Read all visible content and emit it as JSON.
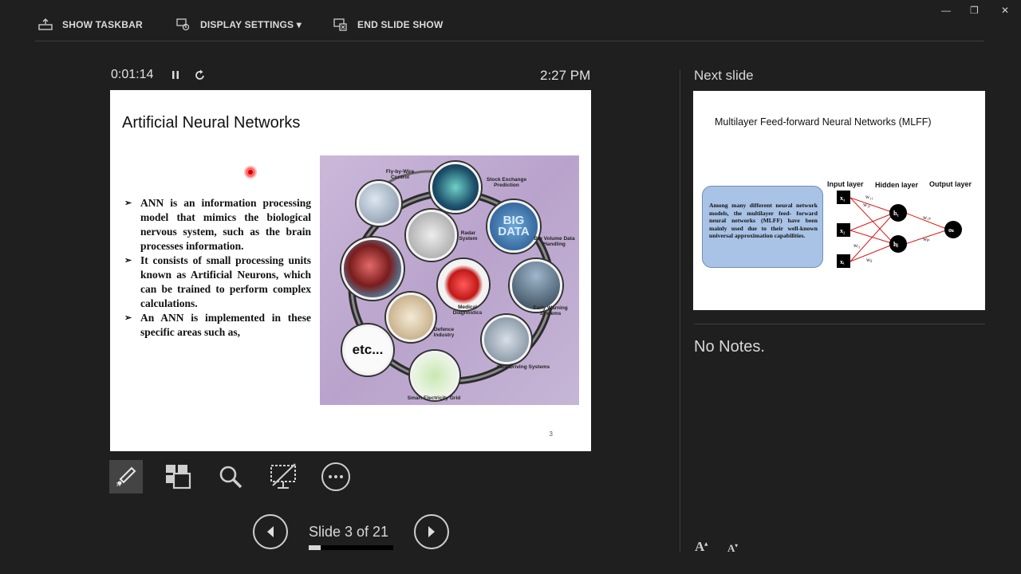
{
  "toolbar": {
    "show_taskbar": "SHOW TASKBAR",
    "display_settings": "DISPLAY SETTINGS ▾",
    "end_slide_show": "END SLIDE SHOW"
  },
  "timer": {
    "elapsed": "0:01:14",
    "clock": "2:27 PM"
  },
  "slide": {
    "title": "Artificial Neural Networks",
    "bullets": [
      "ANN is an information processing model that mimics the biological nervous system, such as the brain processes information.",
      "It consists of small processing units known as Artificial Neurons, which can be trained to perform complex calculations.",
      "An ANN is implemented in these specific areas such as,"
    ],
    "page_number": "3",
    "image_labels": {
      "fly_by_wire": "Fly-by-Wire Control",
      "stock": "Stock Exchange Prediction",
      "big_data_icon": "BIG DATA",
      "big_volume": "Big Volume Data Handling",
      "radar": "Radar System",
      "medical": "Medical Diagnostics",
      "early_warning": "Early Warning Systems",
      "defence": "Defence Industry",
      "etc": "etc...",
      "safe_driving": "Safe Driving Systems",
      "smart_grid": "Smart Electricity Grid"
    }
  },
  "navigation": {
    "slide_status": "Slide 3 of 21",
    "progress": 0.143
  },
  "next_slide": {
    "label": "Next slide",
    "title": "Multilayer Feed-forward Neural Networks (MLFF)",
    "box_text": "Among many different neural network models, the multilayer feed- forward neural networks (MLFF) have been mainly used due to their well-known universal approximation capabilities.",
    "layers": {
      "input": "Input layer",
      "hidden": "Hidden layer",
      "output": "Output layer"
    },
    "nodes": {
      "x1": "x₁",
      "x2": "x₂",
      "xi": "xᵢ",
      "h1": "h₁",
      "hj": "hⱼ",
      "ok": "oₖ"
    },
    "weights": {
      "w11": "w₁₁",
      "w1j": "w₁ⱼ",
      "wi1": "wᵢ₁",
      "wij": "wᵢⱼ",
      "w1k": "w₁ₖ",
      "wjk": "wⱼₖ"
    }
  },
  "notes": {
    "text": "No Notes."
  },
  "colors": {
    "background": "#1f1f1f",
    "box_fill": "#a9c3e6"
  }
}
